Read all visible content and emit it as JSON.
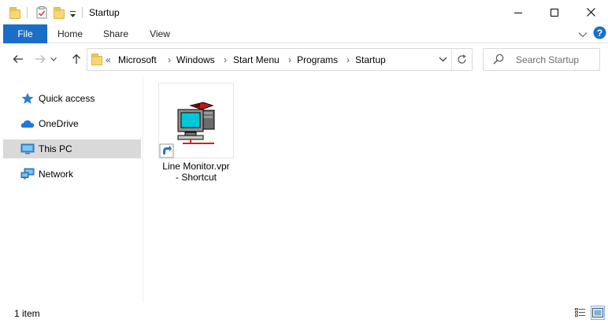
{
  "window": {
    "title": "Startup",
    "minimize_glyph": "minimize-icon",
    "maximize_glyph": "maximize-icon",
    "close_glyph": "close-icon"
  },
  "ribbon": {
    "tabs": [
      {
        "label": "File",
        "active": true
      },
      {
        "label": "Home"
      },
      {
        "label": "Share"
      },
      {
        "label": "View"
      }
    ],
    "help_icon": "help-icon",
    "expand_icon": "chevron-down-icon"
  },
  "address": {
    "overflow": "«",
    "crumbs": [
      "Microsoft",
      "Windows",
      "Start Menu",
      "Programs",
      "Startup"
    ],
    "search_placeholder": "Search Startup"
  },
  "nav": {
    "items": [
      {
        "label": "Quick access",
        "icon": "star-icon"
      },
      {
        "label": "OneDrive",
        "icon": "cloud-icon"
      },
      {
        "label": "This PC",
        "icon": "computer-icon",
        "selected": true
      },
      {
        "label": "Network",
        "icon": "network-icon"
      }
    ]
  },
  "files": [
    {
      "name_line1": "Line Monitor.vpr",
      "name_line2": "- Shortcut",
      "icon": "network-terminal-icon",
      "shortcut": true
    }
  ],
  "status": {
    "item_count": "1 item"
  },
  "colors": {
    "accent": "#1a6ec7",
    "folder": "#f7d774",
    "selected_nav": "#d9d9d9"
  }
}
